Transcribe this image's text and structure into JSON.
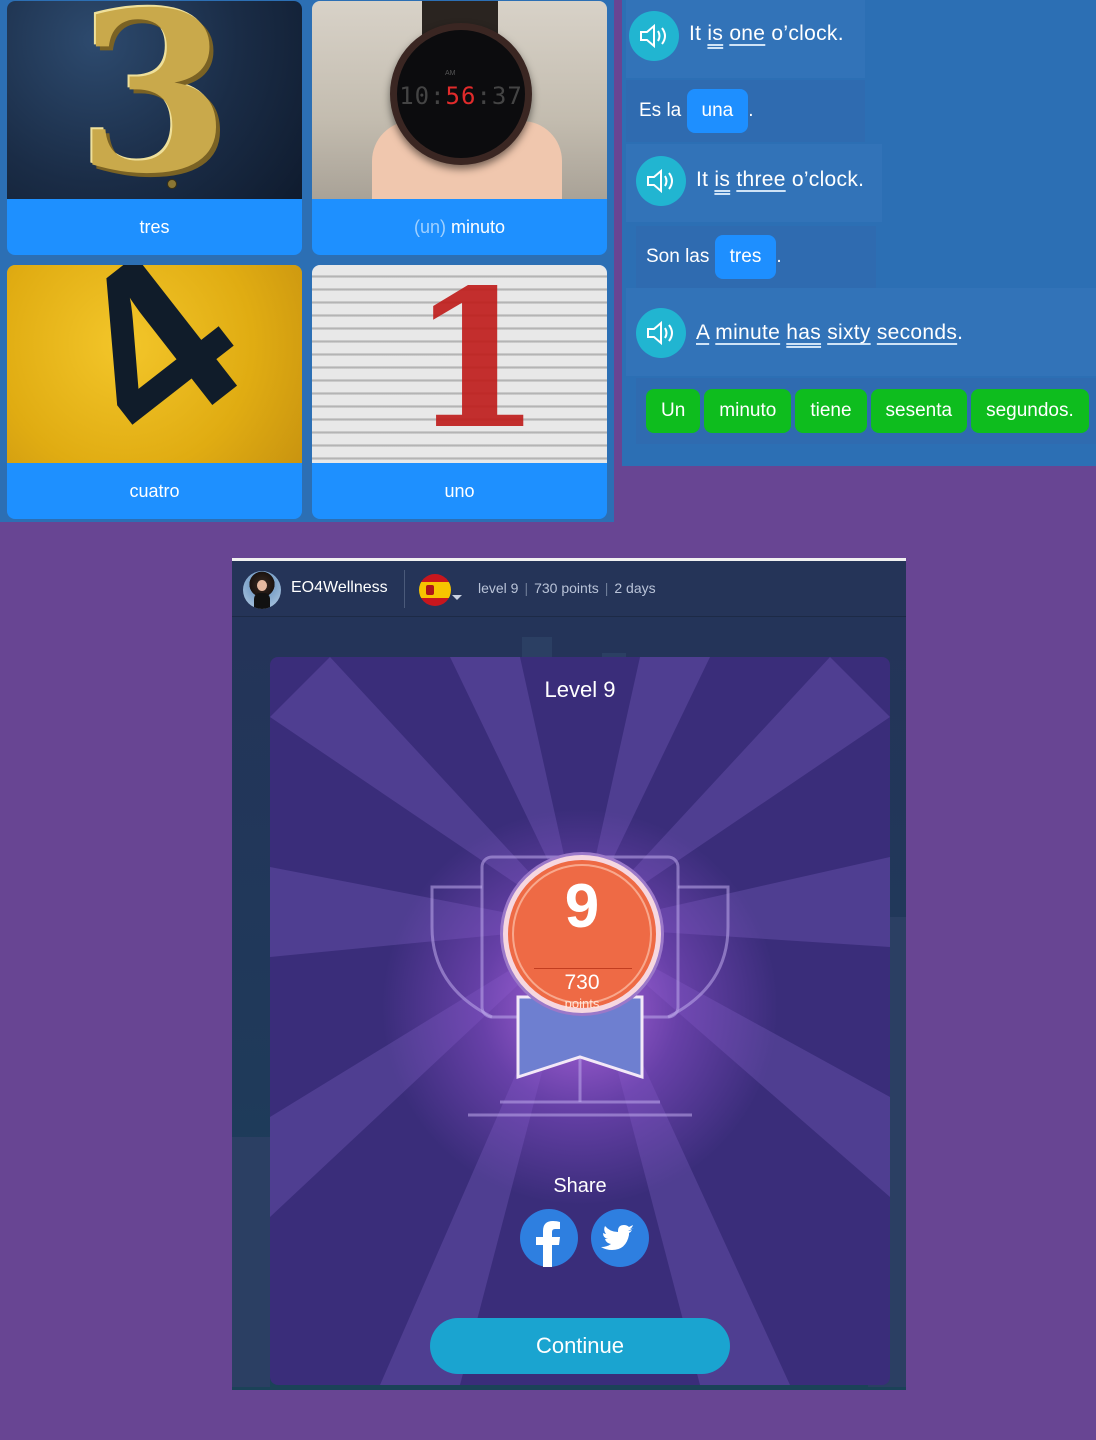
{
  "flashcards": [
    {
      "muted": "",
      "word": "tres"
    },
    {
      "muted": "(un)",
      "word": "minuto"
    },
    {
      "muted": "",
      "word": "cuatro"
    },
    {
      "muted": "",
      "word": "uno"
    }
  ],
  "card_images": {
    "three": "3",
    "watch_small": "AM",
    "watch_hm_left": "10:",
    "watch_hm_red": "56",
    "watch_sec": ":37",
    "four": "4",
    "one": "1"
  },
  "sentences": {
    "s1_en": {
      "w1": "It",
      "w2": "is",
      "w3": "one",
      "w4": "o’clock."
    },
    "s1_es": {
      "before": "Es la",
      "answer": "una",
      "after": "."
    },
    "s2_en": {
      "w1": "It",
      "w2": "is",
      "w3": "three",
      "w4": "o’clock."
    },
    "s2_es": {
      "before": "Son las",
      "answer": "tres",
      "after": "."
    },
    "s3_en": {
      "w1": "A",
      "w2": "minute",
      "w3": "has",
      "w4": "sixty",
      "w5": "seconds",
      "w6": "."
    },
    "s3_es_words": [
      "Un",
      "minuto",
      "tiene",
      "sesenta",
      "segundos."
    ]
  },
  "profile": {
    "username": "EO4Wellness",
    "level": "level 9",
    "points": "730 points",
    "streak": "2 days",
    "language_flag": "spain-flag-icon"
  },
  "level_modal": {
    "title": "Level 9",
    "badge_level": "9",
    "badge_points": "730",
    "badge_points_label": "points",
    "share_label": "Share",
    "continue_label": "Continue"
  },
  "colors": {
    "page_bg": "#684593",
    "card_blue": "#1e90ff",
    "chip_green": "#0ebd1e",
    "speaker_cyan": "#21b5d1",
    "badge_orange": "#ee6a45",
    "continue_button": "#1aa4d0"
  }
}
